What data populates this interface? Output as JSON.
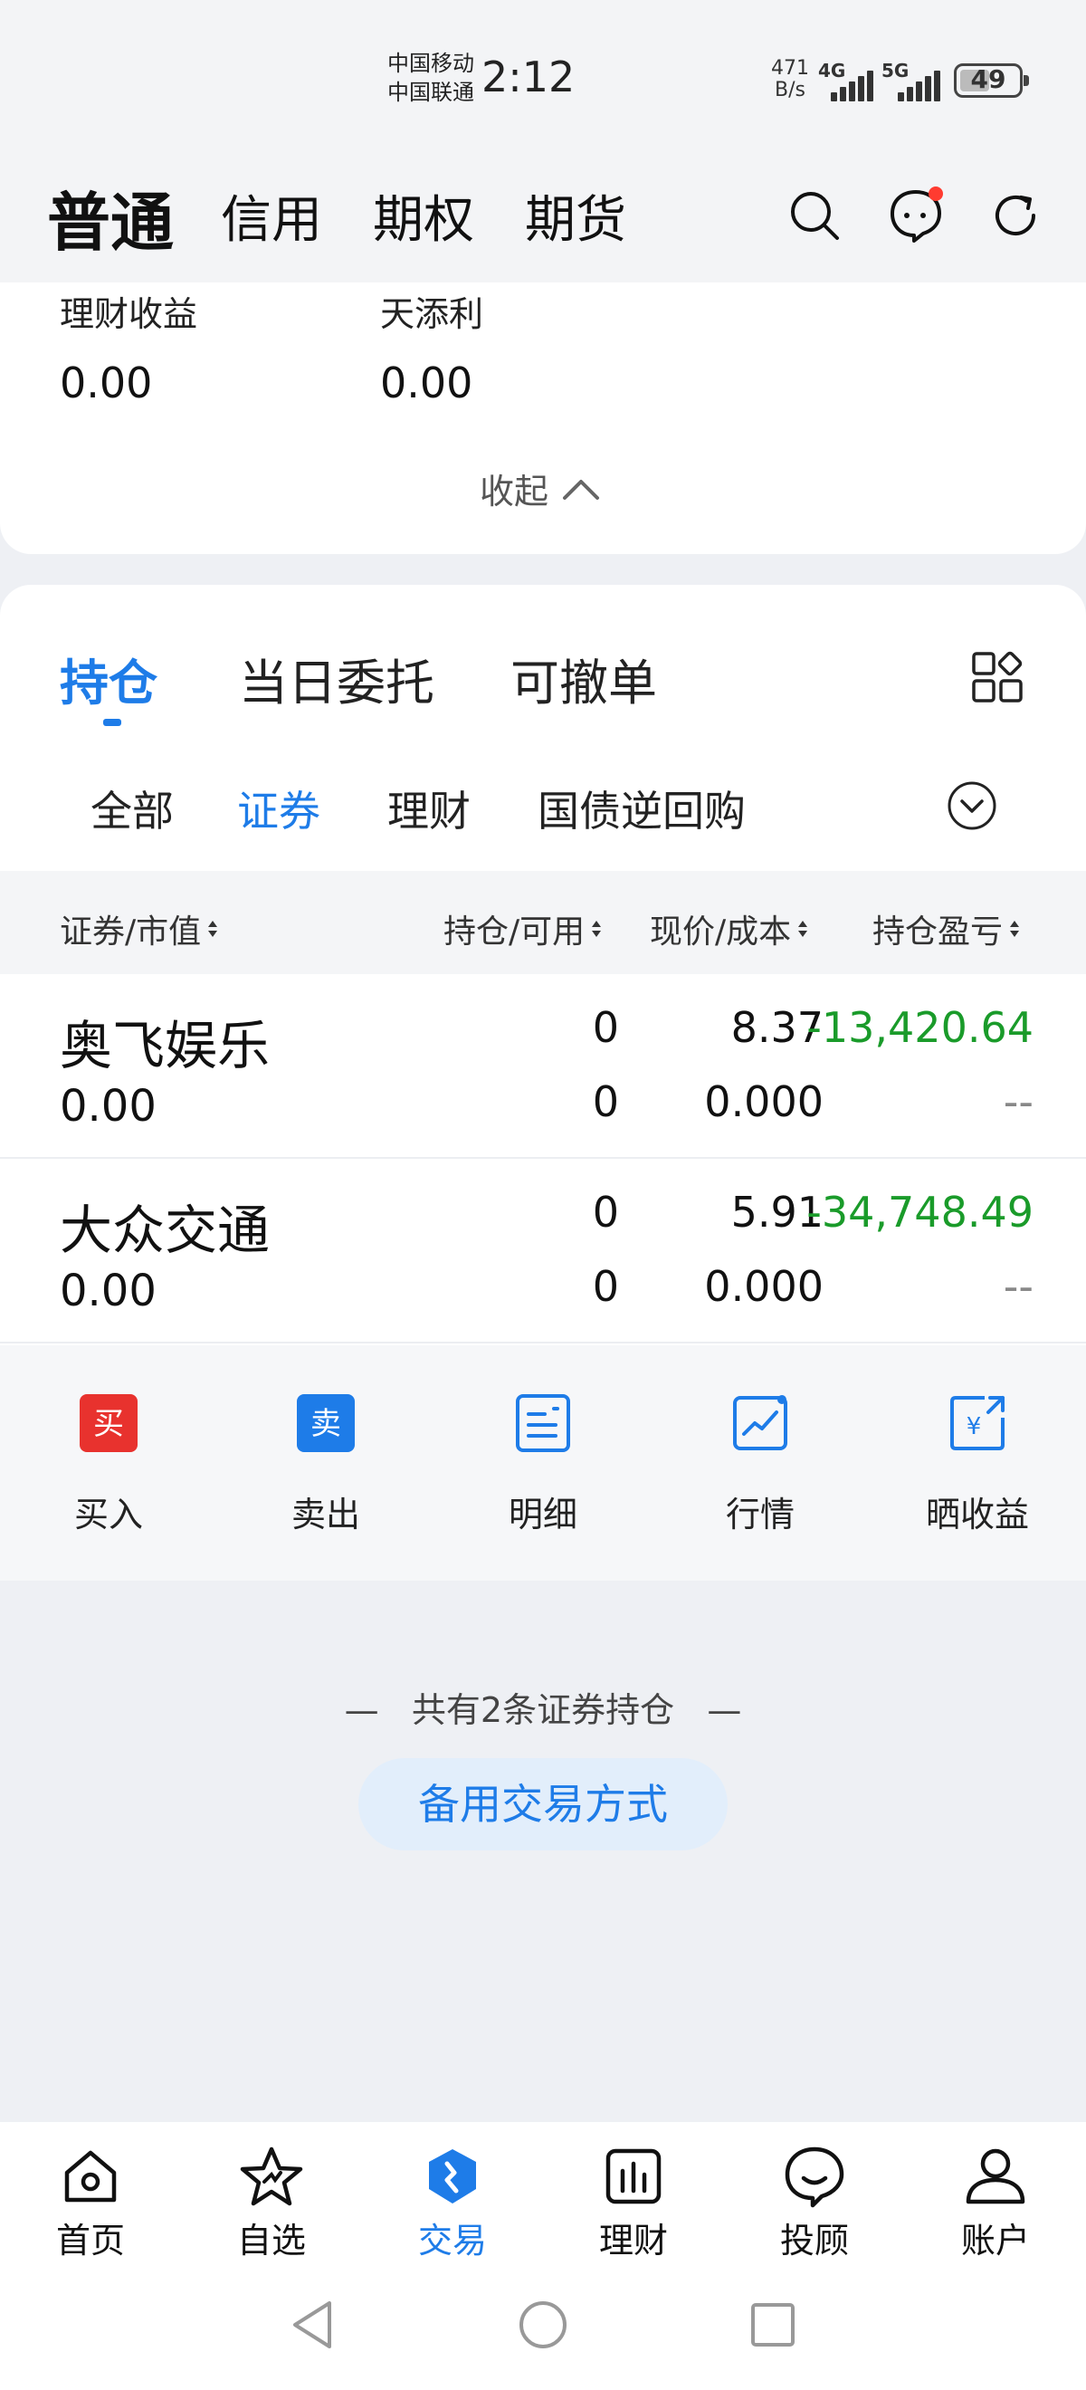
{
  "status_bar": {
    "carrier1": "中国移动",
    "carrier2": "中国联通",
    "time": "2:12",
    "net_speed_value": "471",
    "net_speed_unit": "B/s",
    "signal1": "4G",
    "signal2": "5G",
    "battery": "49"
  },
  "top_tabs": [
    "普通",
    "信用",
    "期权",
    "期货"
  ],
  "summary": {
    "items": [
      {
        "label": "理财收益",
        "value": "0.00"
      },
      {
        "label": "天添利",
        "value": "0.00"
      }
    ],
    "collapse_label": "收起"
  },
  "position_tabs": [
    "持仓",
    "当日委托",
    "可撤单"
  ],
  "sub_tabs": [
    "全部",
    "证券",
    "理财",
    "国债逆回购"
  ],
  "table": {
    "headers": [
      "证券/市值",
      "持仓/可用",
      "现价/成本",
      "持仓盈亏"
    ],
    "rows": [
      {
        "name": "奥飞娱乐",
        "market_value": "0.00",
        "holding": "0",
        "available": "0",
        "price": "8.37",
        "cost": "0.000",
        "pnl": "-13,420.64",
        "pnl_ratio": "--"
      },
      {
        "name": "大众交通",
        "market_value": "0.00",
        "holding": "0",
        "available": "0",
        "price": "5.91",
        "cost": "0.000",
        "pnl": "-34,748.49",
        "pnl_ratio": "--"
      }
    ]
  },
  "actions": [
    {
      "label": "买入",
      "icon": "buy-icon",
      "icon_text": "买",
      "color": "#e8322e"
    },
    {
      "label": "卖出",
      "icon": "sell-icon",
      "icon_text": "卖",
      "color": "#1e7ce8"
    },
    {
      "label": "明细",
      "icon": "detail-icon"
    },
    {
      "label": "行情",
      "icon": "market-icon"
    },
    {
      "label": "晒收益",
      "icon": "share-profit-icon",
      "icon_text": "¥"
    }
  ],
  "footer": {
    "total_text": "共有2条证券持仓",
    "backup_button": "备用交易方式"
  },
  "bottom_nav": [
    {
      "label": "首页",
      "icon": "home-icon"
    },
    {
      "label": "自选",
      "icon": "star-icon"
    },
    {
      "label": "交易",
      "icon": "trade-icon",
      "active": true
    },
    {
      "label": "理财",
      "icon": "finance-icon"
    },
    {
      "label": "投顾",
      "icon": "advisor-icon"
    },
    {
      "label": "账户",
      "icon": "account-icon"
    }
  ],
  "colors": {
    "accent": "#1e7ce8",
    "loss": "#1a9b2a",
    "buy": "#e8322e",
    "notification": "#ff3b30"
  }
}
